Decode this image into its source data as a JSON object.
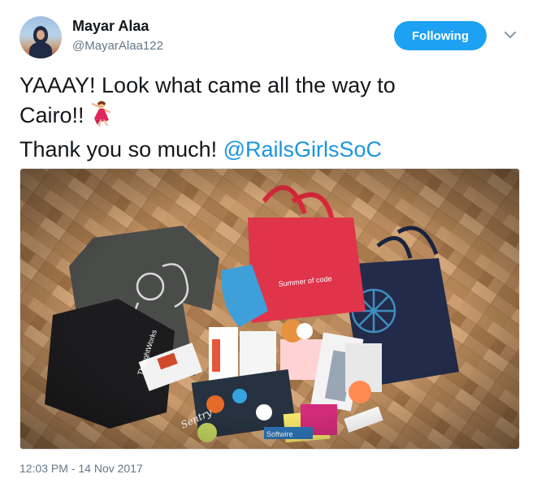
{
  "user": {
    "name": "Mayar Alaa",
    "handle": "@MayarAlaa122"
  },
  "follow_button": {
    "label": "Following"
  },
  "tweet": {
    "line1": "YAAAY! Look what came all the way to",
    "line2": "Cairo!!",
    "line3_prefix": "Thank you so much! ",
    "mention": "@RailsGirlsSoC",
    "emoji": "dancer-emoji"
  },
  "photo": {
    "printed_text": [
      "Summer of code",
      "ThoughtWorks",
      "Sentry",
      "Softwire",
      "GitHub"
    ]
  },
  "timestamp": "12:03 PM - 14 Nov 2017",
  "colors": {
    "accent": "#1da1f2",
    "mention": "#1b95e0",
    "secondary_text": "#657786",
    "primary_text": "#14171a"
  },
  "icons": [
    "dancer-emoji",
    "chevron-down-icon"
  ]
}
